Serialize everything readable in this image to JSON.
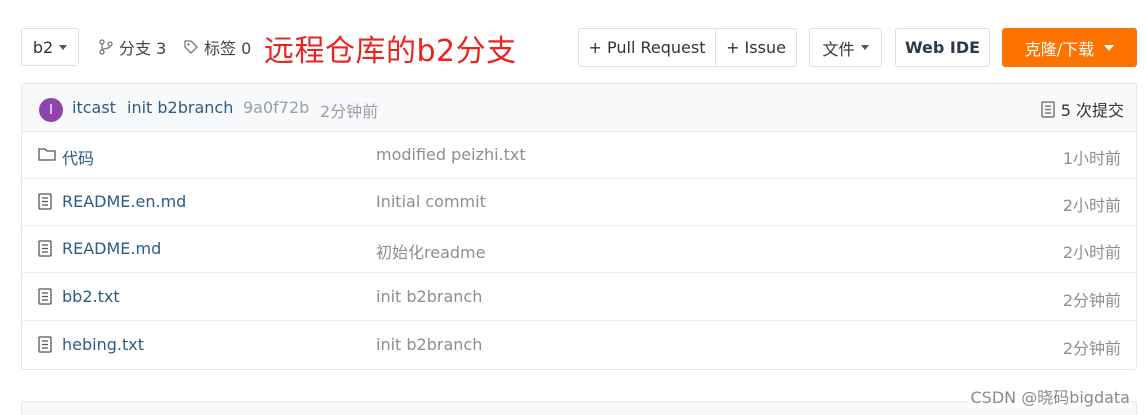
{
  "toolbar": {
    "branch": "b2",
    "branches_label": "分支 3",
    "tags_label": "标签 0",
    "annotation": "远程仓库的b2分支",
    "pull_request_label": "+ Pull Request",
    "issue_label": "+ Issue",
    "files_label": "文件",
    "webide_label": "Web IDE",
    "clone_label": "克隆/下载",
    "clone_color": "#fe7300"
  },
  "commit": {
    "avatar_letter": "I",
    "author": "itcast",
    "message": "init b2branch",
    "hash": "9a0f72b",
    "time": "2分钟前",
    "count_label": "5 次提交"
  },
  "files": [
    {
      "type": "folder",
      "name": "代码",
      "message": "modified peizhi.txt",
      "time": "1小时前"
    },
    {
      "type": "file",
      "name": "README.en.md",
      "message": "Initial commit",
      "time": "2小时前"
    },
    {
      "type": "file",
      "name": "README.md",
      "message": "初始化readme",
      "time": "2小时前"
    },
    {
      "type": "file",
      "name": "bb2.txt",
      "message": "init b2branch",
      "time": "2分钟前"
    },
    {
      "type": "file",
      "name": "hebing.txt",
      "message": "init b2branch",
      "time": "2分钟前"
    }
  ],
  "watermark": "CSDN @晓码bigdata"
}
